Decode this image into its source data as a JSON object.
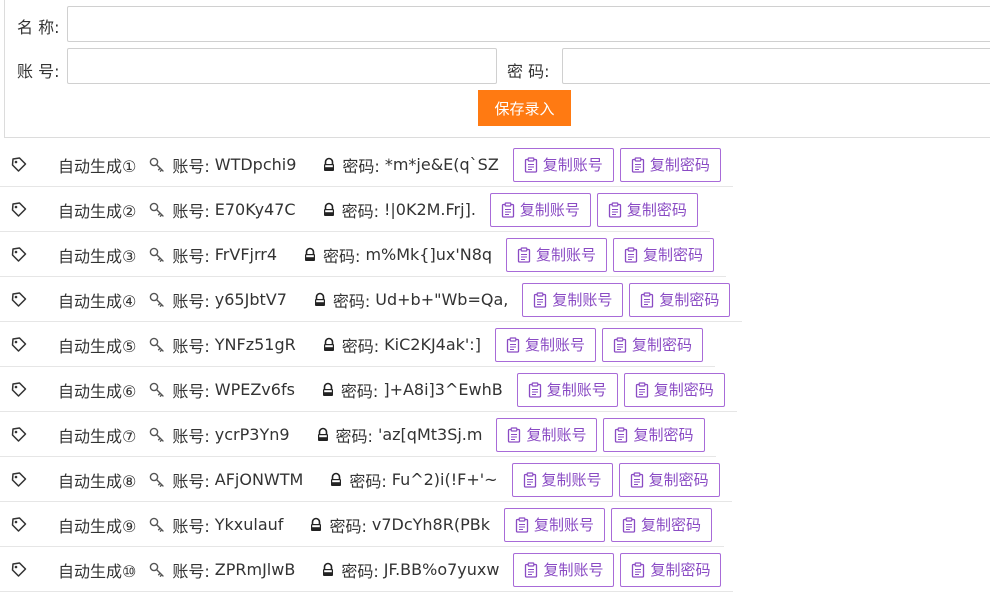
{
  "form": {
    "name_label": "名 称:",
    "account_label": "账 号:",
    "password_label": "密 码:",
    "save_button": "保存录入",
    "accent_color": "#ff7a12"
  },
  "item_labels": {
    "account": "账号:",
    "password": "密码:",
    "copy_account": "复制账号",
    "copy_password": "复制密码"
  },
  "items": [
    {
      "name": "自动生成①",
      "account": "WTDpchi9",
      "password": "*m*je&E(q`SZ"
    },
    {
      "name": "自动生成②",
      "account": "E70Ky47C",
      "password": "!|0K2M.Frj]."
    },
    {
      "name": "自动生成③",
      "account": "FrVFjrr4",
      "password": "m%Mk{]ux'N8q"
    },
    {
      "name": "自动生成④",
      "account": "y65JbtV7",
      "password": "Ud+b+\"Wb=Qa,"
    },
    {
      "name": "自动生成⑤",
      "account": "YNFz51gR",
      "password": "KiC2KJ4ak':]"
    },
    {
      "name": "自动生成⑥",
      "account": "WPEZv6fs",
      "password": "]+A8i]3^EwhB"
    },
    {
      "name": "自动生成⑦",
      "account": "ycrP3Yn9",
      "password": "'az[qMt3Sj.m"
    },
    {
      "name": "自动生成⑧",
      "account": "AFjONWTM",
      "password": "Fu^2)i(!F+'~"
    },
    {
      "name": "自动生成⑨",
      "account": "Ykxulauf",
      "password": "v7DcYh8R(PBk"
    },
    {
      "name": "自动生成⑩",
      "account": "ZPRmJlwB",
      "password": "JF.BB%o7yuxw"
    }
  ],
  "colors": {
    "copy_button_border": "#a86bd8",
    "copy_button_text": "#8a4bc4",
    "popup_button": "#2f7cf6"
  },
  "icons": {
    "tag": "tag-icon",
    "key": "key-icon",
    "lock": "lock-icon",
    "clipboard": "clipboard-icon"
  }
}
